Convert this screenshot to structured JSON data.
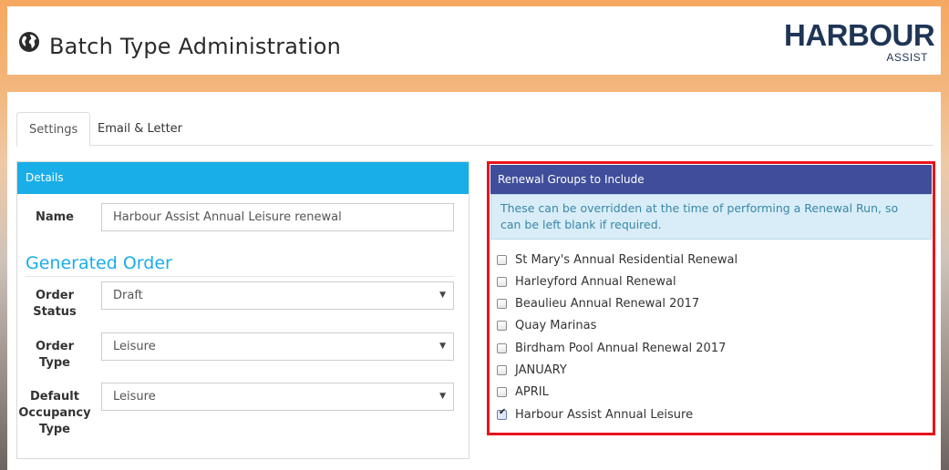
{
  "header": {
    "title": "Batch Type Administration",
    "title_icon": "globe-icon",
    "logo_text": "HARBOUR",
    "logo_subtext": "ASSIST"
  },
  "tabs": [
    {
      "label": "Settings",
      "active": true
    },
    {
      "label": "Email & Letter",
      "active": false
    }
  ],
  "details_panel": {
    "heading": "Details",
    "name_label": "Name",
    "name_value": "Harbour Assist Annual Leisure renewal",
    "section_title": "Generated Order",
    "fields": [
      {
        "label_lines": [
          "Order",
          "Status"
        ],
        "value": "Draft"
      },
      {
        "label_lines": [
          "Order",
          "Type"
        ],
        "value": "Leisure"
      },
      {
        "label_lines": [
          "Default",
          "Occupancy",
          "Type"
        ],
        "value": "Leisure"
      }
    ]
  },
  "renewal_panel": {
    "heading": "Renewal Groups to Include",
    "info": "These can be overridden at the time of performing a Renewal Run, so can be left blank if required.",
    "items": [
      {
        "label": "St Mary's Annual Residential Renewal",
        "checked": false
      },
      {
        "label": "Harleyford Annual Renewal",
        "checked": false
      },
      {
        "label": "Beaulieu Annual Renewal 2017",
        "checked": false
      },
      {
        "label": "Quay Marinas",
        "checked": false
      },
      {
        "label": "Birdham Pool Annual Renewal 2017",
        "checked": false
      },
      {
        "label": "JANUARY",
        "checked": false
      },
      {
        "label": "APRIL",
        "checked": false
      },
      {
        "label": "Harbour Assist Annual Leisure",
        "checked": true
      }
    ]
  },
  "colors": {
    "details_header": "#19aee8",
    "renewal_header": "#3f4e9b",
    "highlight_border": "#e8141b",
    "info_background": "#d8edf7"
  }
}
